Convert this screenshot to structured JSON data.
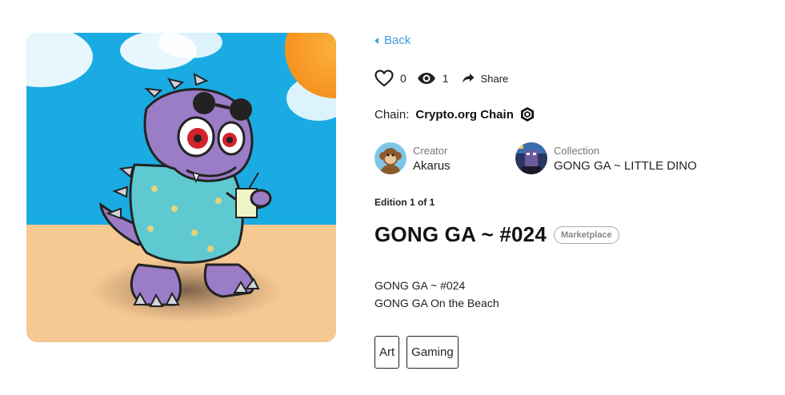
{
  "nav": {
    "back_label": "Back"
  },
  "stats": {
    "likes": "0",
    "views": "1",
    "share_label": "Share"
  },
  "chain": {
    "label": "Chain:",
    "value": "Crypto.org Chain"
  },
  "creator": {
    "role": "Creator",
    "name": "Akarus"
  },
  "collection": {
    "role": "Collection",
    "name": "GONG GA ~  LITTLE DINO"
  },
  "item": {
    "edition": "Edition 1 of 1",
    "title": "GONG GA ~ #024",
    "badge": "Marketplace",
    "description": [
      "GONG GA ~ #024",
      "GONG GA On the Beach"
    ]
  },
  "tags": [
    "Art",
    "Gaming"
  ],
  "icons": {
    "back": "caret-left-icon",
    "like": "heart-outline-icon",
    "views": "eye-icon",
    "share": "share-arrow-icon",
    "chain": "crypto-org-hexagon-icon"
  },
  "colors": {
    "link": "#3ba0db",
    "text": "#111111",
    "muted": "#777777",
    "badge": "#888888"
  }
}
